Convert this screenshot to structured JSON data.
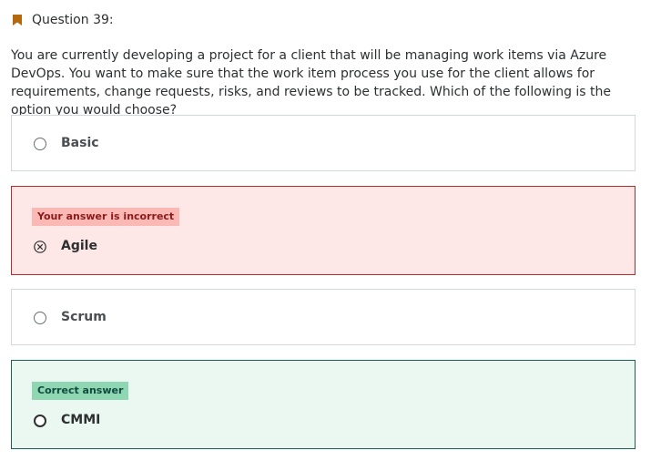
{
  "question": {
    "heading": "Question 39:",
    "text": "You are currently developing a project for a client that will be managing work items via Azure DevOps. You want to make sure that the work item process you use for the client allows for requirements, change requests, risks, and reviews to be tracked. Which of the following is the option you would choose?"
  },
  "options": [
    {
      "label": "Basic",
      "state": "neutral"
    },
    {
      "label": "Agile",
      "state": "incorrect",
      "badge": "Your answer is incorrect"
    },
    {
      "label": "Scrum",
      "state": "neutral"
    },
    {
      "label": "CMMI",
      "state": "correct",
      "badge": "Correct answer"
    }
  ],
  "colors": {
    "bookmark": "#b4690e",
    "incorrect_bg": "#fde7e7",
    "incorrect_border": "#b32d2e",
    "correct_bg": "#ebf8f2",
    "correct_border": "#1e6055"
  },
  "icons": {
    "question_marker": "bookmark-icon",
    "selected_wrong": "x-circle-icon",
    "unselected": "radio-icon"
  }
}
